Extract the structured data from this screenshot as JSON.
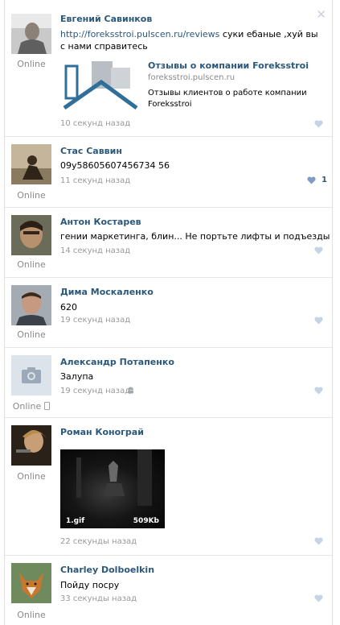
{
  "colors": {
    "link": "#2b587a",
    "meta": "#999999",
    "heart": "#c5d4e4",
    "divider": "#e4e8ed"
  },
  "posts": [
    {
      "author": "Евгений Савинков",
      "status": "Online",
      "link_url": "http://foreksstroi.pulscen.ru/reviews",
      "text": " суки ебаные ,хуй вы с нами справитесь",
      "link_card": {
        "title": "Отзывы о компании Foreksstroi",
        "domain": "foreksstroi.pulscen.ru",
        "description": "Отзывы клиентов о работе компании Foreksstroi"
      },
      "time": "10 секунд назад",
      "close_icon": "close-icon"
    },
    {
      "author": "Стас Саввин",
      "status": "Online",
      "text": "09у58605607456734 56",
      "time": "11 секунд назад",
      "likes": "1"
    },
    {
      "author": "Антон Костарев",
      "status": "Online",
      "text": "гении маркетинга, блин... Не портьте лифты и подъезды",
      "time": "14 секунд назад"
    },
    {
      "author": "Дима Москаленко",
      "status": "Online",
      "text": "620",
      "time": "19 секунд назад"
    },
    {
      "author": "Александр Потапенко",
      "status": "Online",
      "text": "Залупа",
      "time": "19 секунд назад",
      "device_icon": "android-icon"
    },
    {
      "author": "Роман Конограй",
      "status": "Online",
      "attachment": {
        "name": "1.gif",
        "size": "509Kb"
      },
      "time": "22 секунды назад"
    },
    {
      "author": "Charley Dolboelkin",
      "status": "Online",
      "text": "Пойду посру",
      "time": "33 секунды назад"
    }
  ]
}
